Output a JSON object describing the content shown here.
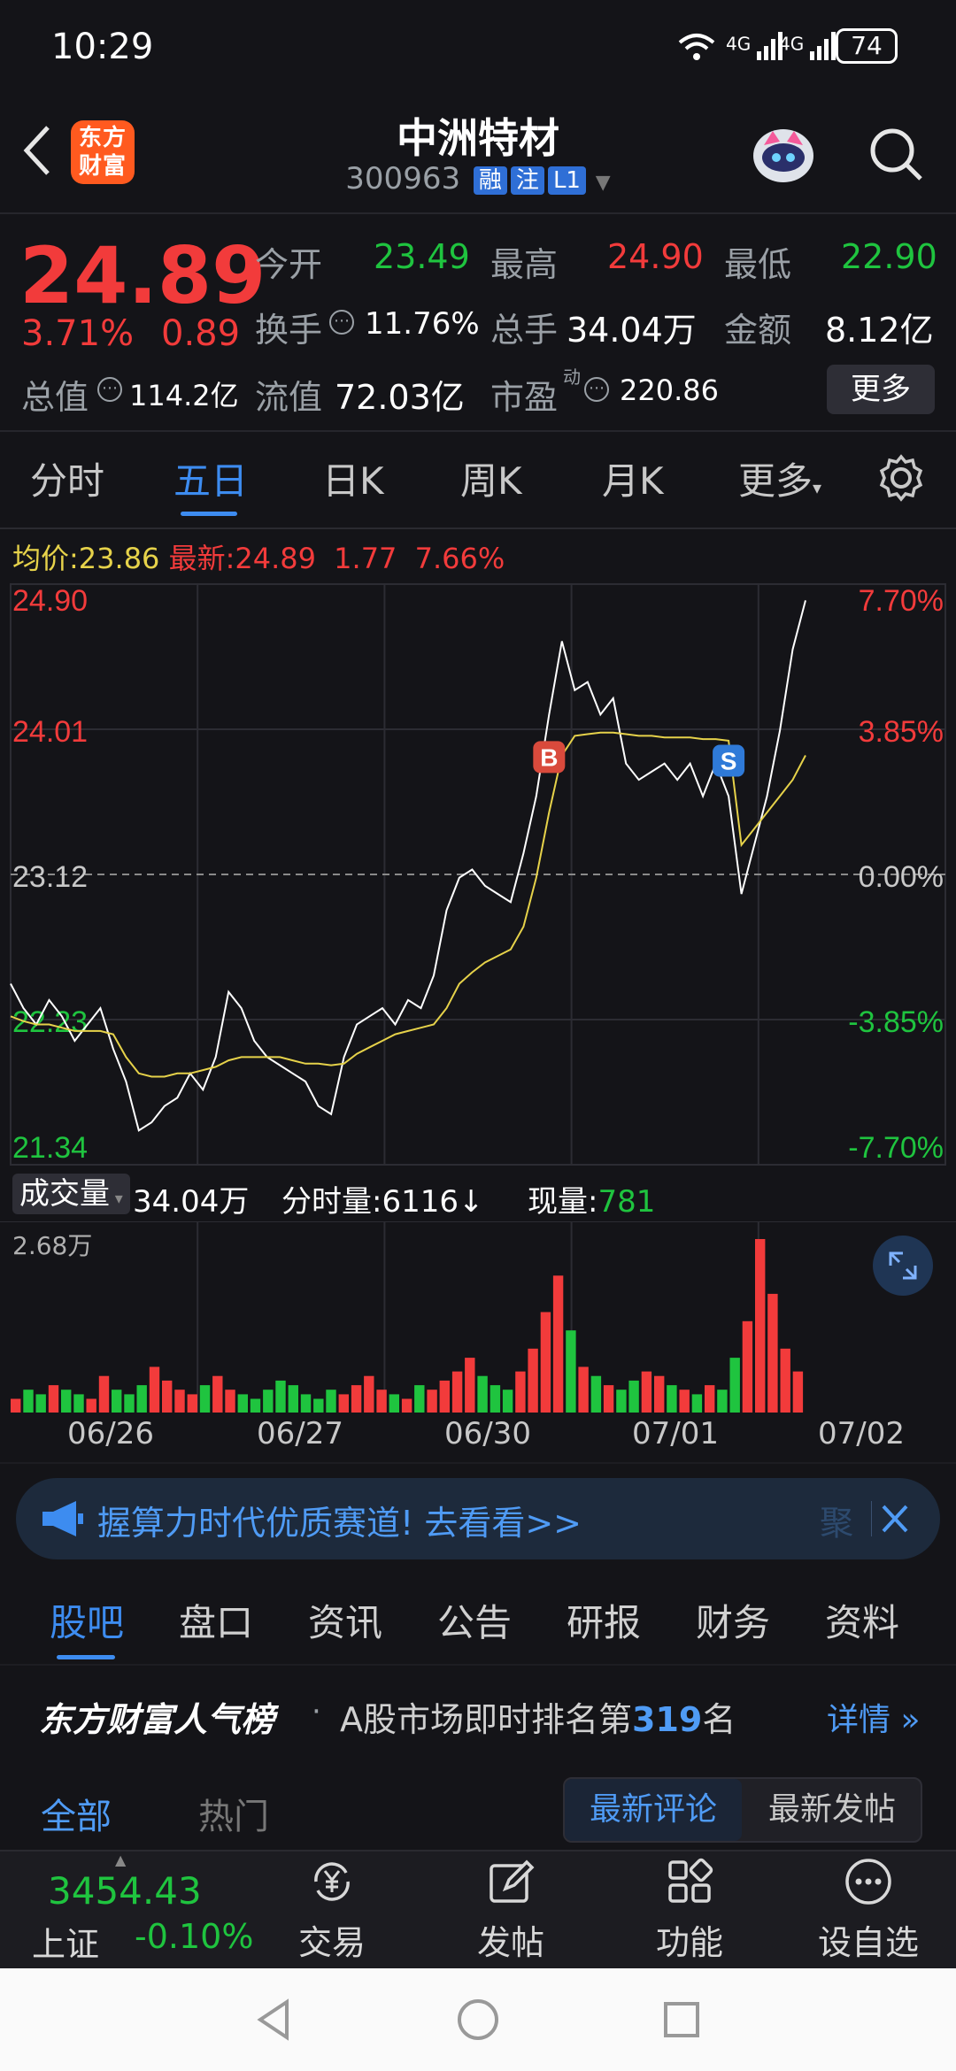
{
  "status": {
    "time": "10:29",
    "battery": "74",
    "net1": "4G",
    "net2": "4G"
  },
  "header": {
    "logo": "东方财富",
    "title": "中洲特材",
    "code": "300963",
    "tags": [
      "融",
      "注",
      "L1"
    ]
  },
  "quote": {
    "price": "24.89",
    "change_pct": "3.71%",
    "change": "0.89",
    "open_label": "今开",
    "open": "23.49",
    "high_label": "最高",
    "high": "24.90",
    "low_label": "最低",
    "low": "22.90",
    "turnover_label": "换手",
    "turnover": "11.76%",
    "volume_label": "总手",
    "volume": "34.04万",
    "amount_label": "金额",
    "amount": "8.12亿",
    "mktcap_label": "总值",
    "mktcap": "114.2亿",
    "float_label": "流值",
    "float": "72.03亿",
    "pe_label": "市盈",
    "pe_sup": "动",
    "pe": "220.86",
    "more_button": "更多"
  },
  "tabs": [
    "分时",
    "五日",
    "日K",
    "周K",
    "月K",
    "更多"
  ],
  "active_tab": "五日",
  "chart_info": {
    "avg_label": "均价:",
    "avg": "23.86",
    "last_label": "最新:",
    "last": "24.89",
    "chg": "1.77",
    "pct": "7.66%"
  },
  "chart_data": {
    "type": "line",
    "title": "",
    "price_ticks": [
      "24.90",
      "24.01",
      "23.12",
      "22.23",
      "21.34"
    ],
    "pct_ticks": [
      "7.70%",
      "3.85%",
      "0.00%",
      "-3.85%",
      "-7.70%"
    ],
    "ylim": [
      21.34,
      24.9
    ],
    "x_labels": [
      "06/26",
      "06/27",
      "06/30",
      "07/01",
      "07/02"
    ],
    "series": [
      {
        "values": [
          22.45,
          22.3,
          22.2,
          22.35,
          22.25,
          22.1,
          22.2,
          22.3,
          22.05,
          21.85,
          21.55,
          21.6,
          21.7,
          21.75,
          21.9,
          21.8,
          22.0,
          22.4,
          22.3,
          22.1,
          22.0,
          21.95,
          21.9,
          21.85,
          21.7,
          21.65,
          22.0,
          22.2,
          22.25,
          22.3,
          22.2,
          22.35,
          22.3,
          22.5,
          22.9,
          23.1,
          23.15,
          23.05,
          23.0,
          22.95,
          23.25,
          23.6,
          24.1,
          24.55,
          24.25,
          24.3,
          24.1,
          24.2,
          23.8,
          23.7,
          23.75,
          23.8,
          23.7,
          23.8,
          23.6,
          23.8,
          23.6,
          23.0,
          23.3,
          23.6,
          24.0,
          24.5,
          24.8
        ]
      },
      {
        "values": [
          22.25,
          22.22,
          22.2,
          22.2,
          22.18,
          22.16,
          22.16,
          22.16,
          22.14,
          22.0,
          21.9,
          21.88,
          21.88,
          21.9,
          21.9,
          21.92,
          21.94,
          21.98,
          22.0,
          22.0,
          22.0,
          22.0,
          21.98,
          21.96,
          21.96,
          21.95,
          21.96,
          22.02,
          22.06,
          22.1,
          22.14,
          22.16,
          22.18,
          22.2,
          22.3,
          22.45,
          22.52,
          22.58,
          22.62,
          22.66,
          22.8,
          23.1,
          23.5,
          23.85,
          23.97,
          23.98,
          23.99,
          23.99,
          23.98,
          23.97,
          23.97,
          23.96,
          23.96,
          23.96,
          23.95,
          23.95,
          23.94,
          23.3,
          23.4,
          23.5,
          23.6,
          23.7,
          23.85
        ]
      }
    ],
    "markers": [
      {
        "label": "B",
        "color": "#d94a3c"
      },
      {
        "label": "S",
        "color": "#2f7ad8"
      }
    ],
    "volume_max": "2.68万",
    "volume": [
      3,
      5,
      4,
      6,
      5,
      4,
      3,
      8,
      5,
      4,
      6,
      10,
      7,
      5,
      4,
      6,
      8,
      5,
      4,
      3,
      5,
      7,
      6,
      4,
      3,
      5,
      4,
      6,
      8,
      5,
      4,
      3,
      6,
      5,
      7,
      9,
      12,
      8,
      6,
      5,
      9,
      14,
      22,
      30,
      18,
      10,
      8,
      6,
      5,
      7,
      9,
      8,
      6,
      5,
      4,
      6,
      5,
      12,
      20,
      38,
      26,
      14,
      9
    ]
  },
  "volume_bar": {
    "label": "成交量",
    "total": "34.04万",
    "tick_label": "分时量:",
    "tick": "6116",
    "now_label": "现量:",
    "now": "781"
  },
  "ad": {
    "text": "握算力时代优质赛道! 去看看>>",
    "tail": "聚"
  },
  "bottom_tabs": [
    "股吧",
    "盘口",
    "资讯",
    "公告",
    "研报",
    "财务",
    "资料"
  ],
  "ranking": {
    "brand": "东方财富人气榜",
    "text_pre": "A股市场即时排名第",
    "rank": "319",
    "text_post": "名",
    "detail": "详情"
  },
  "feed": {
    "all": "全部",
    "hot": "热门",
    "latest_comment": "最新评论",
    "latest_post": "最新发帖"
  },
  "index": {
    "value": "3454.43",
    "name": "上证",
    "change": "-0.10%"
  },
  "nav": [
    {
      "label": "交易",
      "icon": "yen-refresh-icon"
    },
    {
      "label": "发帖",
      "icon": "edit-icon"
    },
    {
      "label": "功能",
      "icon": "grid-icon"
    },
    {
      "label": "设自选",
      "icon": "more-circle-icon"
    }
  ],
  "colors": {
    "up": "#f23b3b",
    "down": "#1fc43f",
    "accent": "#3d8cf0",
    "price_line": "#ffffff",
    "avg_line": "#e6d24a"
  }
}
